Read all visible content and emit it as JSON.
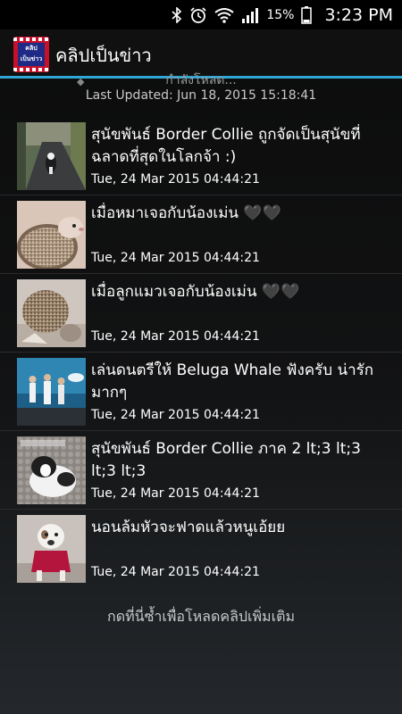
{
  "status_bar": {
    "battery": "15%",
    "time": "3:23 PM",
    "icons": [
      "bluetooth-icon",
      "alarm-icon",
      "wifi-icon",
      "signal-icon",
      "battery-icon"
    ]
  },
  "app": {
    "title": "คลิปเป็นข่าว",
    "logo_text_1": "คลิป",
    "logo_text_2": "เป็นข่าว",
    "accent": "#2fa6d6"
  },
  "refresh": {
    "pull_text": "กำลังโหลด...",
    "last_updated": "Last Updated: Jun 18, 2015 15:18:41"
  },
  "items": [
    {
      "title": "สุนัขพันธ์ Border Collie ถูกจัดเป็นสุนัขที่ฉลาดที่สุดในโลกจ้า :)",
      "date": "Tue, 24 Mar 2015 04:44:21"
    },
    {
      "title": "เมื่อหมาเจอกับน้องเม่น 🖤🖤",
      "date": "Tue, 24 Mar 2015 04:44:21"
    },
    {
      "title": "เมื่อลูกแมวเจอกับน้องเม่น 🖤🖤",
      "date": "Tue, 24 Mar 2015 04:44:21"
    },
    {
      "title": "เล่นดนตรีให้ Beluga Whale ฟังครับ น่ารักมากๆ",
      "date": "Tue, 24 Mar 2015 04:44:21"
    },
    {
      "title": "สุนัขพันธ์ Border Collie ภาค 2  lt;3 lt;3 lt;3 lt;3",
      "date": "Tue, 24 Mar 2015 04:44:21"
    },
    {
      "title": "นอนล้มหัวจะฟาดแล้วหนูเอ้ยย",
      "date": "Tue, 24 Mar 2015 04:44:21"
    }
  ],
  "load_more": "กดที่นี่ซ้ำเพื่อโหลดคลิปเพิ่มเติม"
}
